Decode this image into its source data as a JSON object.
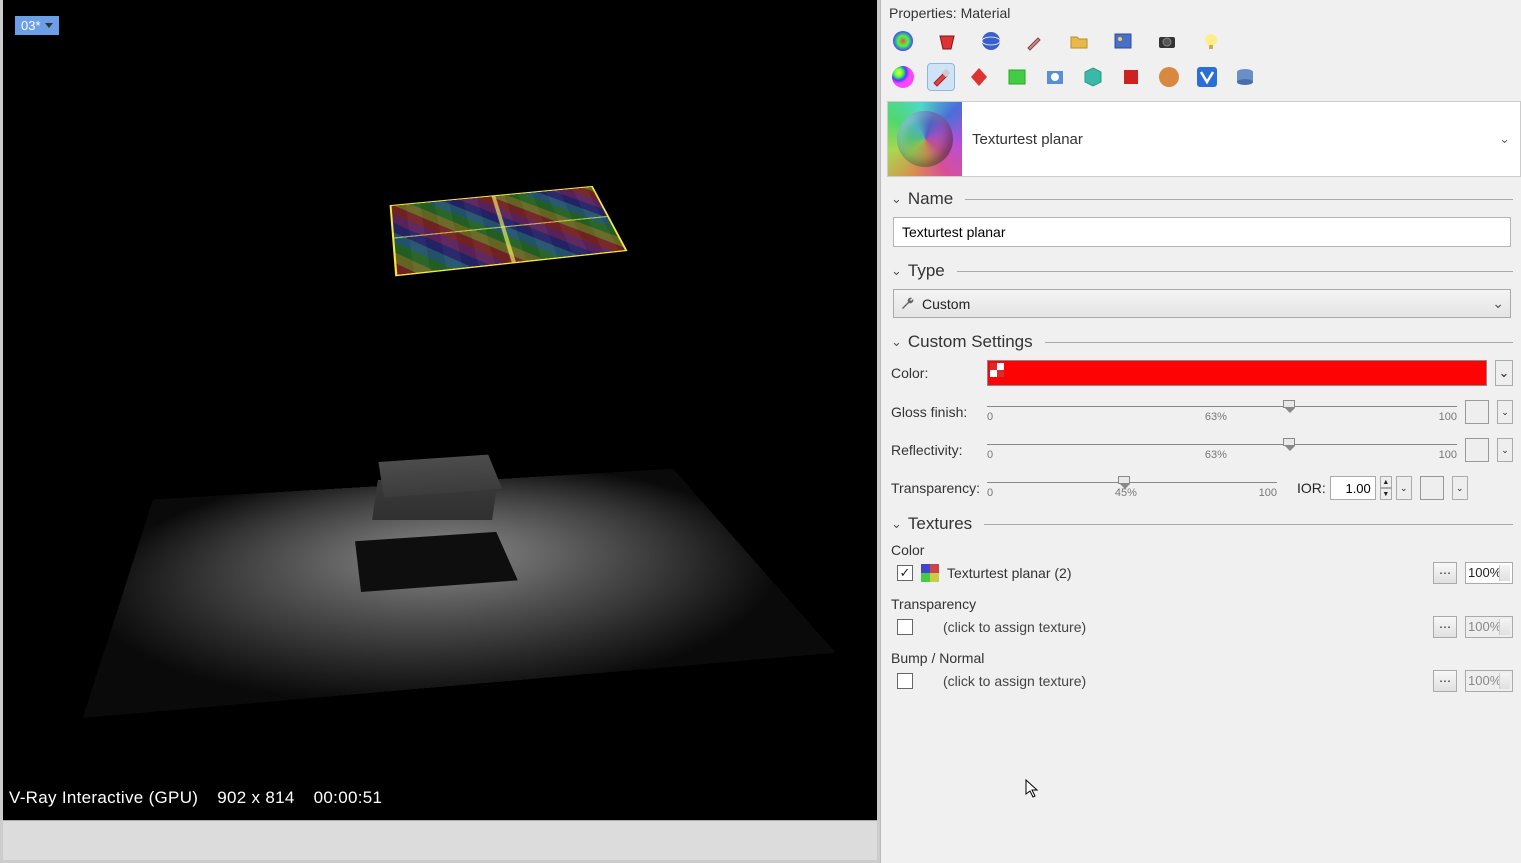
{
  "viewport": {
    "tab_label": "03*",
    "status_renderer": "V-Ray Interactive (GPU)",
    "status_res": "902 x 814",
    "status_time": "00:00:51"
  },
  "panel": {
    "title": "Properties: Material",
    "material_name_header": "Texturtest planar",
    "sections": {
      "name": {
        "label": "Name",
        "value": "Texturtest planar"
      },
      "type": {
        "label": "Type",
        "value": "Custom"
      },
      "custom": {
        "label": "Custom Settings",
        "color_label": "Color:",
        "color_value": "#fd0303",
        "gloss_label": "Gloss finish:",
        "gloss_min": "0",
        "gloss_val": "63%",
        "gloss_max": "100",
        "gloss_pct": 63,
        "refl_label": "Reflectivity:",
        "refl_min": "0",
        "refl_val": "63%",
        "refl_max": "100",
        "refl_pct": 63,
        "trans_label": "Transparency:",
        "trans_min": "0",
        "trans_val": "45%",
        "trans_max": "100",
        "trans_pct": 45,
        "ior_label": "IOR:",
        "ior_value": "1.00"
      },
      "textures": {
        "label": "Textures",
        "color_label": "Color",
        "color_tex_name": "Texturtest planar (2)",
        "color_checked": true,
        "color_pct": "100%",
        "transparency_label": "Transparency",
        "trans_hint": "(click to assign texture)",
        "trans_pct": "100%",
        "bump_label": "Bump / Normal",
        "bump_hint": "(click to assign texture)",
        "bump_pct": "100%"
      }
    }
  },
  "icons_row1": [
    "rainbow-sphere",
    "red-bucket",
    "blue-sphere",
    "brush",
    "folder",
    "picture",
    "camera",
    "lightbulb"
  ],
  "icons_row2": [
    "rainbow-sphere2",
    "paint-tube",
    "red-diamond",
    "green-card",
    "blue-box",
    "teal-cube",
    "red-box",
    "orange-sphere",
    "vray-logo",
    "cylinder"
  ]
}
